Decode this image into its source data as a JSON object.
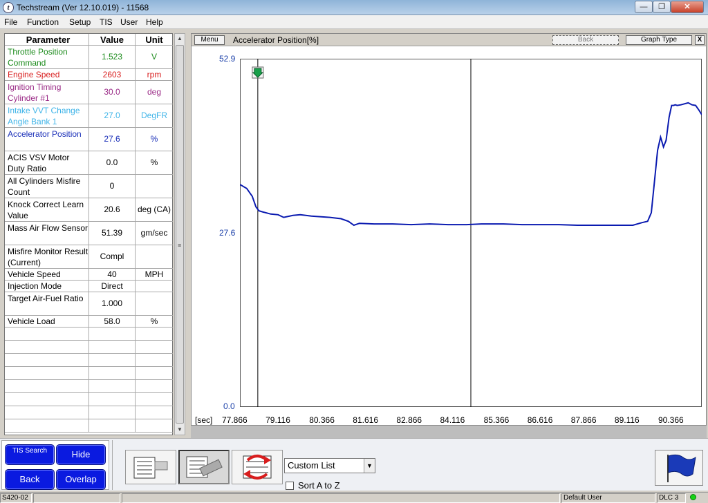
{
  "window": {
    "title": "Techstream (Ver 12.10.019) - 11568",
    "minimize": "—",
    "maximize": "❐",
    "close": "✕"
  },
  "menu": [
    "File",
    "Function",
    "Setup",
    "TIS",
    "User",
    "Help"
  ],
  "table": {
    "headers": {
      "parameter": "Parameter",
      "value": "Value",
      "unit": "Unit"
    },
    "rows": [
      {
        "parameter": "Throttle Position Command",
        "value": "1.523",
        "unit": "V",
        "color": "#1a8a1a"
      },
      {
        "parameter": "Engine Speed",
        "value": "2603",
        "unit": "rpm",
        "color": "#d81d1d"
      },
      {
        "parameter": "Ignition Timing Cylinder #1",
        "value": "30.0",
        "unit": "deg",
        "color": "#9a2a86"
      },
      {
        "parameter": "Intake VVT Change Angle Bank 1",
        "value": "27.0",
        "unit": "DegFR",
        "color": "#3fb4e8"
      },
      {
        "parameter": "Accelerator Position",
        "value": "27.6",
        "unit": "%",
        "color": "#1a2fb8"
      },
      {
        "parameter": "ACIS VSV Motor Duty Ratio",
        "value": "0.0",
        "unit": "%",
        "color": "#000000"
      },
      {
        "parameter": "All Cylinders Misfire Count",
        "value": "0",
        "unit": "",
        "color": "#000000"
      },
      {
        "parameter": "Knock Correct Learn Value",
        "value": "20.6",
        "unit": "deg (CA)",
        "color": "#000000"
      },
      {
        "parameter": "Mass Air Flow Sensor",
        "value": "51.39",
        "unit": "gm/sec",
        "color": "#000000"
      },
      {
        "parameter": "Misfire Monitor Result (Current)",
        "value": "Compl",
        "unit": "",
        "color": "#000000"
      },
      {
        "parameter": "Vehicle Speed",
        "value": "40",
        "unit": "MPH",
        "color": "#000000"
      },
      {
        "parameter": "Injection Mode",
        "value": "Direct",
        "unit": "",
        "color": "#000000"
      },
      {
        "parameter": "Target Air-Fuel Ratio",
        "value": "1.000",
        "unit": "",
        "color": "#000000"
      },
      {
        "parameter": "Vehicle Load",
        "value": "58.0",
        "unit": "%",
        "color": "#000000"
      }
    ],
    "empty_rows": 8
  },
  "graph": {
    "menu_label": "Menu",
    "title": "Accelerator Position[%]",
    "back_label": "Back",
    "graph_type_label": "Graph Type",
    "close_label": "X",
    "x_unit": "[sec]",
    "line_color": "#0a1ab0"
  },
  "chart_data": {
    "type": "line",
    "title": "Accelerator Position[%]",
    "xlabel": "[sec]",
    "ylabel": "",
    "ylim": [
      0,
      52.9
    ],
    "xlim": [
      77.866,
      90.366
    ],
    "yticks": [
      "52.9",
      "27.6",
      "0.0"
    ],
    "xticks": [
      "77.866",
      "79.116",
      "80.366",
      "81.616",
      "82.866",
      "84.116",
      "85.366",
      "86.616",
      "87.866",
      "89.116",
      "90.366"
    ],
    "cursors_x": [
      78.35,
      84.116
    ],
    "series": [
      {
        "x": [
          77.866,
          78.05,
          78.2,
          78.3,
          78.38,
          78.5,
          78.7,
          78.9,
          79.05,
          79.3,
          79.5,
          79.8,
          80.3,
          80.6,
          80.8,
          80.95,
          81.1,
          81.5,
          82.0,
          82.5,
          83.0,
          83.5,
          84.0,
          84.4,
          85.0,
          85.5,
          86.0,
          86.5,
          87.0,
          87.5,
          88.0,
          88.5,
          88.75,
          88.9,
          89.0,
          89.1,
          89.17,
          89.25,
          89.33,
          89.4,
          89.48,
          89.55,
          89.6,
          89.65,
          89.7,
          89.8,
          90.0,
          90.1,
          90.2,
          90.3,
          90.366
        ],
        "y": [
          33.8,
          33.2,
          32.0,
          30.4,
          29.8,
          29.6,
          29.3,
          29.2,
          28.8,
          29.1,
          29.2,
          29.0,
          28.8,
          28.6,
          28.2,
          27.6,
          27.9,
          27.8,
          27.8,
          27.7,
          27.8,
          27.7,
          27.7,
          27.8,
          27.8,
          27.7,
          27.7,
          27.7,
          27.6,
          27.6,
          27.6,
          27.6,
          28.0,
          28.2,
          29.5,
          35.0,
          39.0,
          41.0,
          39.5,
          40.5,
          44.0,
          45.8,
          45.8,
          45.9,
          45.8,
          45.9,
          46.2,
          45.9,
          45.8,
          45.0,
          44.4
        ]
      }
    ]
  },
  "nav": {
    "tis_search": "TIS Search",
    "hide": "Hide",
    "back": "Back",
    "overlap": "Overlap"
  },
  "toolbar": {
    "custom_list": "Custom List",
    "sort_label": "Sort A to Z"
  },
  "status": {
    "code": "S420-02",
    "user": "Default User",
    "dlc": "DLC 3",
    "led_color": "#17d417"
  }
}
